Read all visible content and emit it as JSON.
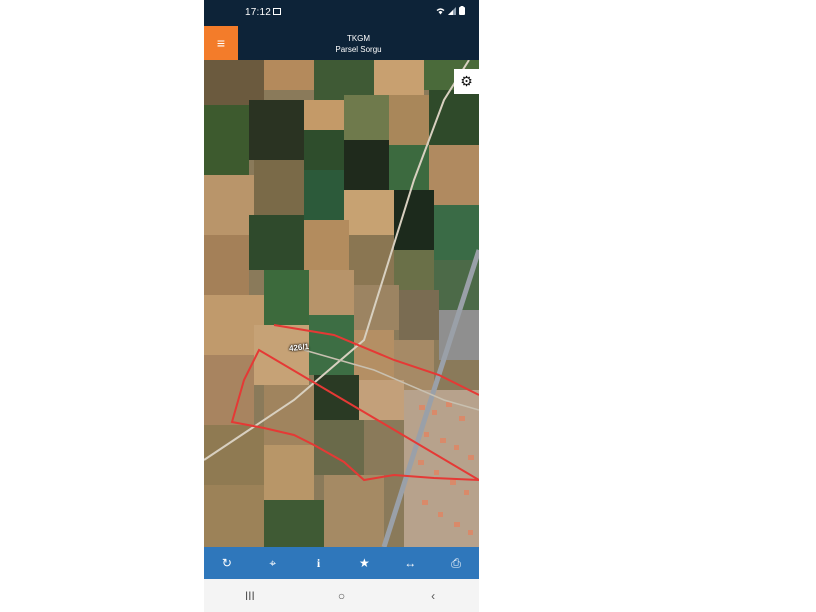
{
  "status_bar": {
    "time": "17:12",
    "icons": [
      "image-icon",
      "wifi-icon",
      "signal-icon",
      "battery-icon"
    ]
  },
  "app_bar": {
    "title_line1": "TKGM",
    "title_line2": "Parsel Sorgu",
    "menu_icon": "≡",
    "accent_color": "#f37c2a",
    "background_color": "#0d2338"
  },
  "map": {
    "parcel_label": "426/1",
    "parcel_outline_color": "#e53935",
    "settings_icon": "⚙"
  },
  "toolbar": {
    "background_color": "#2f77bb",
    "items": [
      {
        "name": "refresh-icon",
        "glyph": "↻"
      },
      {
        "name": "locate-icon",
        "glyph": "⌖"
      },
      {
        "name": "info-icon",
        "glyph": "i"
      },
      {
        "name": "star-icon",
        "glyph": "★"
      },
      {
        "name": "measure-icon",
        "glyph": "↔"
      },
      {
        "name": "print-icon",
        "glyph": "⎙"
      }
    ]
  },
  "nav_bar": {
    "recents": "III",
    "home": "○",
    "back": "‹"
  }
}
